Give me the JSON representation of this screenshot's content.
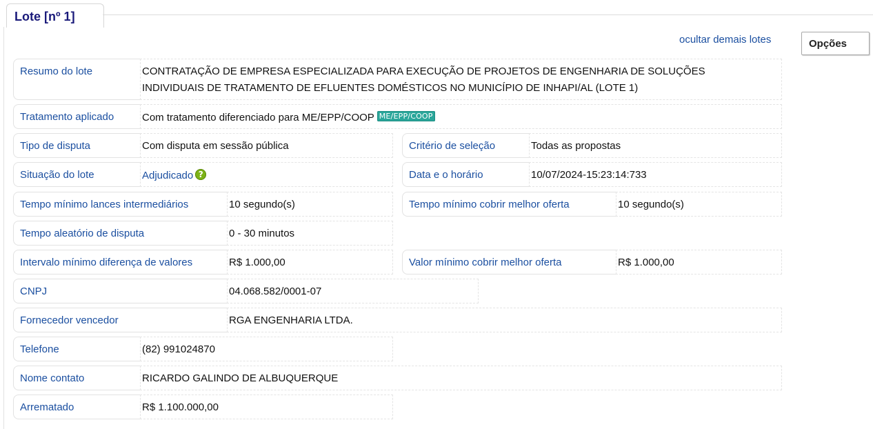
{
  "tab_title": "Lote [nº 1]",
  "hide_link": "ocultar demais lotes",
  "options_button": "Opções",
  "resumo": {
    "label": "Resumo do lote",
    "line1": "CONTRATAÇÃO DE EMPRESA ESPECIALIZADA PARA EXECUÇÃO DE PROJETOS DE ENGENHARIA DE SOLUÇÕES",
    "line2": "INDIVIDUAIS DE TRATAMENTO DE EFLUENTES DOMÉSTICOS NO MUNICÍPIO DE INHAPI/AL (LOTE 1)"
  },
  "tratamento": {
    "label": "Tratamento aplicado",
    "value": "Com tratamento diferenciado para ME/EPP/COOP",
    "badge": "ME/EPP/COOP"
  },
  "tipo_disputa": {
    "label": "Tipo de disputa",
    "value": "Com disputa em sessão pública"
  },
  "criterio": {
    "label": "Critério de seleção",
    "value": "Todas as propostas"
  },
  "situacao": {
    "label": "Situação do lote",
    "value": "Adjudicado",
    "help_icon": "?"
  },
  "data_horario": {
    "label": "Data e o horário",
    "value": "10/07/2024-15:23:14:733"
  },
  "tempo_min_lances": {
    "label": "Tempo mínimo lances intermediários",
    "value": "10 segundo(s)"
  },
  "tempo_min_cobrir": {
    "label": "Tempo mínimo cobrir melhor oferta",
    "value": "10 segundo(s)"
  },
  "tempo_aleatorio": {
    "label": "Tempo aleatório de disputa",
    "value": "0 - 30 minutos"
  },
  "intervalo_min": {
    "label": "Intervalo mínimo diferença de valores",
    "value": "R$ 1.000,00"
  },
  "valor_min_cobrir": {
    "label": "Valor mínimo cobrir melhor oferta",
    "value": "R$ 1.000,00"
  },
  "cnpj": {
    "label": "CNPJ",
    "value": "04.068.582/0001-07"
  },
  "fornecedor": {
    "label": "Fornecedor vencedor",
    "value": "RGA ENGENHARIA LTDA."
  },
  "telefone": {
    "label": "Telefone",
    "value": "(82) 991024870"
  },
  "nome_contato": {
    "label": "Nome contato",
    "value": "RICARDO GALINDO DE ALBUQUERQUE"
  },
  "arrematado": {
    "label": "Arrematado",
    "value": "R$ 1.100.000,00"
  },
  "colors": {
    "label": "#1b4fa0",
    "title": "#1a1a7a",
    "badge": "#2aa69a",
    "help": "#7db317"
  }
}
